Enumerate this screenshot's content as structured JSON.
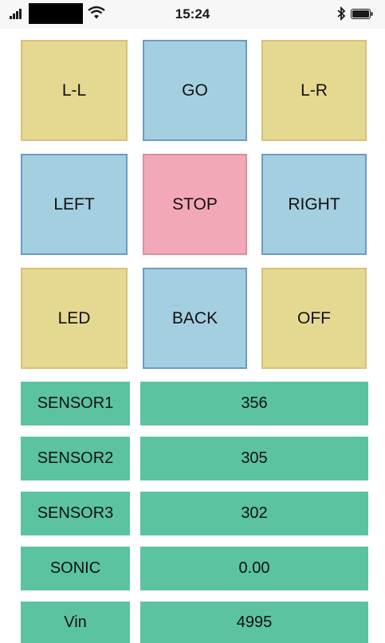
{
  "status_bar": {
    "time": "15:24",
    "icons": [
      "signal-icon",
      "wifi-icon",
      "bluetooth-icon",
      "battery-icon"
    ]
  },
  "controls": [
    {
      "label": "L-L",
      "color": "#e5d992"
    },
    {
      "label": "GO",
      "color": "#a4cfe0"
    },
    {
      "label": "L-R",
      "color": "#e5d992"
    },
    {
      "label": "LEFT",
      "color": "#a4cfe0"
    },
    {
      "label": "STOP",
      "color": "#f3a8b8"
    },
    {
      "label": "RIGHT",
      "color": "#a4cfe0"
    },
    {
      "label": "LED",
      "color": "#e5d992"
    },
    {
      "label": "BACK",
      "color": "#a4cfe0"
    },
    {
      "label": "OFF",
      "color": "#e5d992"
    }
  ],
  "readings": [
    {
      "label": "SENSOR1",
      "value": "356"
    },
    {
      "label": "SENSOR2",
      "value": "305"
    },
    {
      "label": "SENSOR3",
      "value": "302"
    },
    {
      "label": "SONIC",
      "value": "0.00"
    },
    {
      "label": "Vin",
      "value": "4995"
    }
  ],
  "colors": {
    "reading_bg": "#5bc3a0"
  }
}
